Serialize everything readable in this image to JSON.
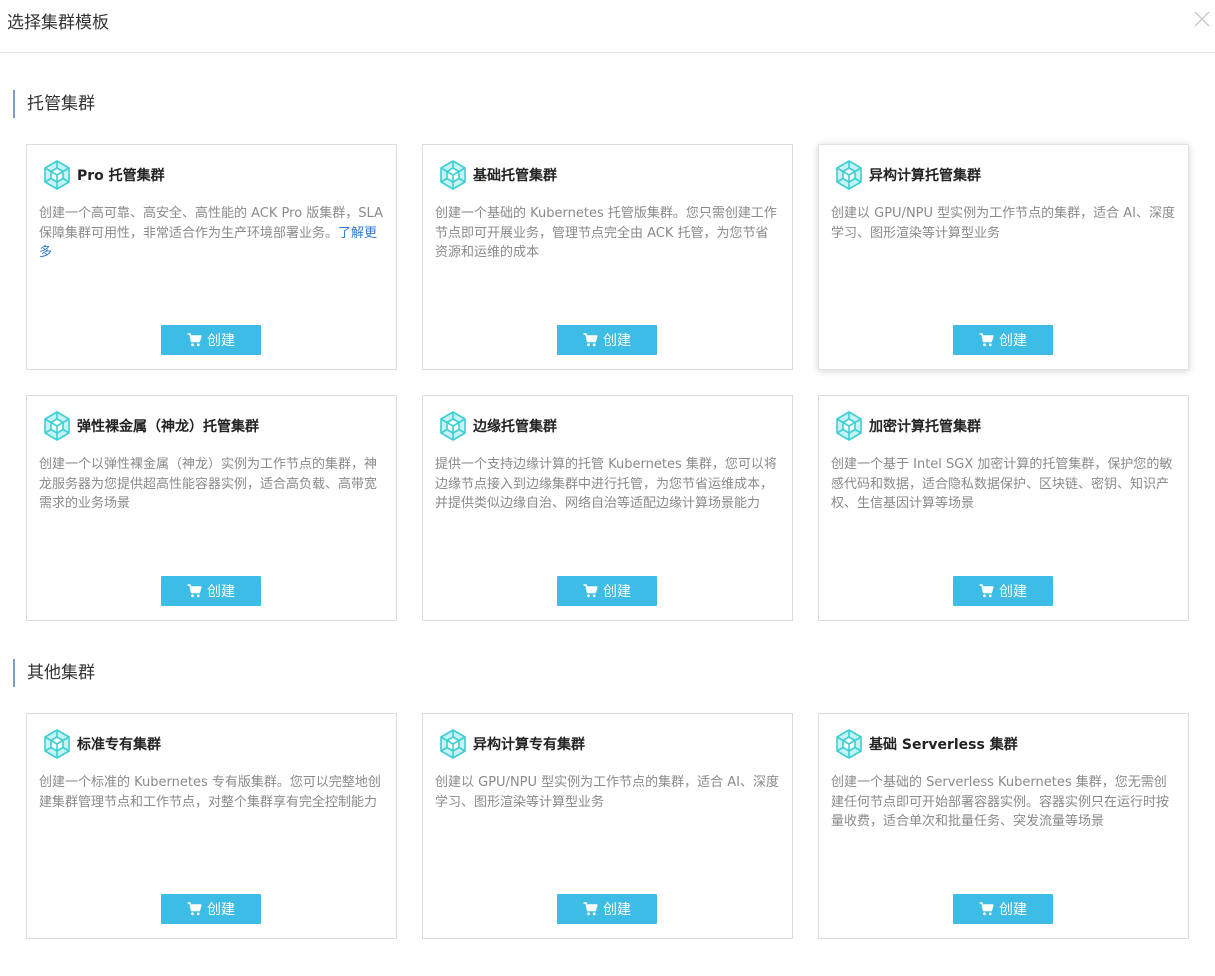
{
  "dialog": {
    "title": "选择集群模板"
  },
  "sections": [
    {
      "title": "托管集群"
    },
    {
      "title": "其他集群"
    }
  ],
  "cards": [
    {
      "title": "Pro 托管集群",
      "desc": "创建一个高可靠、高安全、高性能的 ACK Pro 版集群，SLA 保障集群可用性，非常适合作为生产环境部署业务。",
      "link": "了解更多",
      "button": "创建"
    },
    {
      "title": "基础托管集群",
      "desc": "创建一个基础的 Kubernetes 托管版集群。您只需创建工作节点即可开展业务，管理节点完全由 ACK 托管，为您节省资源和运维的成本",
      "button": "创建"
    },
    {
      "title": "异构计算托管集群",
      "desc": "创建以 GPU/NPU 型实例为工作节点的集群，适合 AI、深度学习、图形渲染等计算型业务",
      "button": "创建"
    },
    {
      "title": "弹性裸金属（神龙）托管集群",
      "desc": "创建一个以弹性裸金属（神龙）实例为工作节点的集群，神龙服务器为您提供超高性能容器实例，适合高负载、高带宽需求的业务场景",
      "button": "创建"
    },
    {
      "title": "边缘托管集群",
      "desc": "提供一个支持边缘计算的托管 Kubernetes 集群，您可以将边缘节点接入到边缘集群中进行托管，为您节省运维成本，并提供类似边缘自治、网络自治等适配边缘计算场景能力",
      "button": "创建"
    },
    {
      "title": "加密计算托管集群",
      "desc": "创建一个基于 Intel SGX 加密计算的托管集群，保护您的敏感代码和数据，适合隐私数据保护、区块链、密钥、知识产权、生信基因计算等场景",
      "button": "创建"
    },
    {
      "title": "标准专有集群",
      "desc": "创建一个标准的 Kubernetes 专有版集群。您可以完整地创建集群管理节点和工作节点，对整个集群享有完全控制能力",
      "button": "创建"
    },
    {
      "title": "异构计算专有集群",
      "desc": "创建以 GPU/NPU 型实例为工作节点的集群，适合 AI、深度学习、图形渲染等计算型业务",
      "button": "创建"
    },
    {
      "title": "基础 Serverless 集群",
      "desc": "创建一个基础的 Serverless Kubernetes 集群，您无需创建任何节点即可开始部署容器实例。容器实例只在运行时按量收费，适合单次和批量任务、突发流量等场景",
      "button": "创建"
    }
  ],
  "colors": {
    "button": "#3dbde5",
    "link": "#2c7bd3",
    "icon": "#3ccfd4",
    "section_bar": "#7f9cc4"
  },
  "icons": {
    "card": "hexagon-cube-icon",
    "button": "shopping-cart-icon",
    "close": "close-icon"
  }
}
